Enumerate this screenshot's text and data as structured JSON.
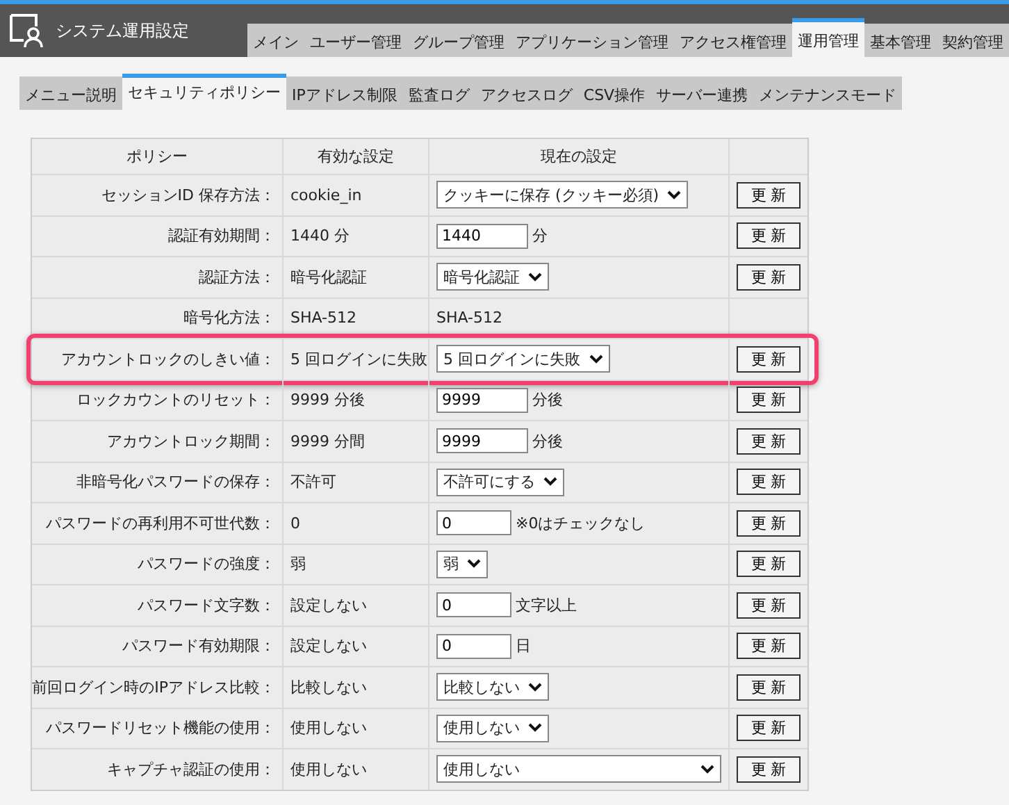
{
  "header": {
    "title": "システム運用設定"
  },
  "main_tabs": [
    {
      "label": "メイン",
      "selected": false
    },
    {
      "label": "ユーザー管理",
      "selected": false
    },
    {
      "label": "グループ管理",
      "selected": false
    },
    {
      "label": "アプリケーション管理",
      "selected": false
    },
    {
      "label": "アクセス権管理",
      "selected": false
    },
    {
      "label": "運用管理",
      "selected": true
    },
    {
      "label": "基本管理",
      "selected": false
    },
    {
      "label": "契約管理",
      "selected": false
    }
  ],
  "sub_tabs": [
    {
      "label": "メニュー説明",
      "selected": false
    },
    {
      "label": "セキュリティポリシー",
      "selected": true
    },
    {
      "label": "IPアドレス制限",
      "selected": false
    },
    {
      "label": "監査ログ",
      "selected": false
    },
    {
      "label": "アクセスログ",
      "selected": false
    },
    {
      "label": "CSV操作",
      "selected": false
    },
    {
      "label": "サーバー連携",
      "selected": false
    },
    {
      "label": "メンテナンスモード",
      "selected": false
    }
  ],
  "table": {
    "columns": [
      "ポリシー",
      "有効な設定",
      "現在の設定"
    ],
    "rows": [
      {
        "policy": "セッションID 保存方法：",
        "effective": "cookie_in",
        "control": {
          "kind": "select",
          "value": "クッキーに保存 (クッキー必須)"
        },
        "button": "更 新",
        "highlighted": false
      },
      {
        "policy": "認証有効期間：",
        "effective": "1440 分",
        "control": {
          "kind": "input",
          "value": "1440",
          "suffix": "分"
        },
        "button": "更 新",
        "highlighted": false
      },
      {
        "policy": "認証方法：",
        "effective": "暗号化認証",
        "control": {
          "kind": "select",
          "value": "暗号化認証"
        },
        "button": "更 新",
        "highlighted": false
      },
      {
        "policy": "暗号化方法：",
        "effective": "SHA-512",
        "control": {
          "kind": "text",
          "value": "SHA-512"
        },
        "highlighted": false
      },
      {
        "policy": "アカウントロックのしきい値：",
        "effective": "5 回ログインに失敗",
        "control": {
          "kind": "select",
          "value": "5 回ログインに失敗"
        },
        "button": "更 新",
        "highlighted": true
      },
      {
        "policy": "ロックカウントのリセット：",
        "effective": "9999 分後",
        "control": {
          "kind": "input",
          "value": "9999",
          "suffix": "分後"
        },
        "button": "更 新",
        "highlighted": false
      },
      {
        "policy": "アカウントロック期間：",
        "effective": "9999 分間",
        "control": {
          "kind": "input",
          "value": "9999",
          "suffix": "分後"
        },
        "button": "更 新",
        "highlighted": false
      },
      {
        "policy": "非暗号化パスワードの保存：",
        "effective": "不許可",
        "control": {
          "kind": "select",
          "value": "不許可にする"
        },
        "button": "更 新",
        "highlighted": false
      },
      {
        "policy": "パスワードの再利用不可世代数：",
        "effective": "0",
        "control": {
          "kind": "input",
          "value": "0",
          "suffix": "※0はチェックなし"
        },
        "button": "更 新",
        "highlighted": false
      },
      {
        "policy": "パスワードの強度：",
        "effective": "弱",
        "control": {
          "kind": "select",
          "value": "弱"
        },
        "button": "更 新",
        "highlighted": false
      },
      {
        "policy": "パスワード文字数：",
        "effective": "設定しない",
        "control": {
          "kind": "input",
          "value": "0",
          "suffix": "文字以上"
        },
        "button": "更 新",
        "highlighted": false
      },
      {
        "policy": "パスワード有効期限：",
        "effective": "設定しない",
        "control": {
          "kind": "input",
          "value": "0",
          "suffix": "日"
        },
        "button": "更 新",
        "highlighted": false
      },
      {
        "policy": "前回ログイン時のIPアドレス比較：",
        "effective": "比較しない",
        "control": {
          "kind": "select",
          "value": "比較しない"
        },
        "button": "更 新",
        "highlighted": false
      },
      {
        "policy": "パスワードリセット機能の使用：",
        "effective": "使用しない",
        "control": {
          "kind": "select",
          "value": "使用しない"
        },
        "button": "更 新",
        "highlighted": false
      },
      {
        "policy": "キャプチャ認証の使用：",
        "effective": "使用しない",
        "control": {
          "kind": "wide_select",
          "value": "使用しない"
        },
        "button": "更 新",
        "highlighted": false
      }
    ]
  }
}
